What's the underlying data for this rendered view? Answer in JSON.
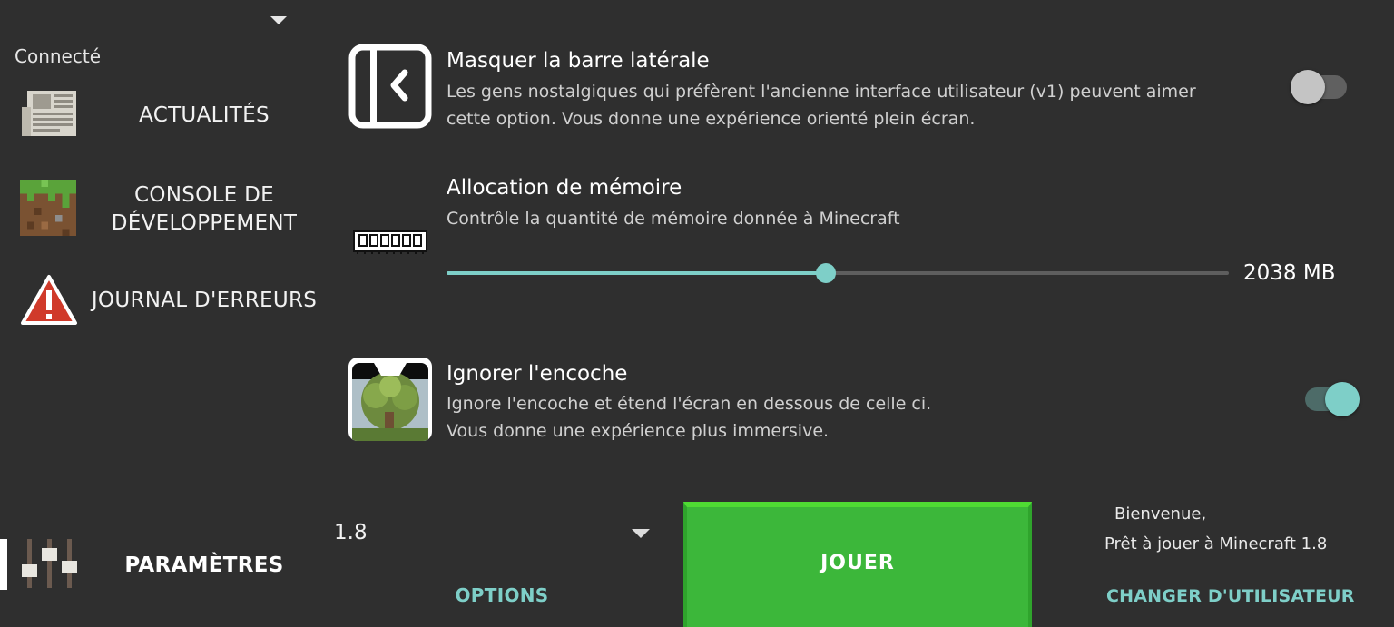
{
  "sidebar": {
    "status": "Connecté",
    "items": [
      {
        "label": "ACTUALITÉS",
        "icon": "newspaper-icon"
      },
      {
        "label_line1": "CONSOLE DE",
        "label_line2": "DÉVELOPPEMENT",
        "icon": "grass-block-icon"
      },
      {
        "label": "JOURNAL D'ERREURS",
        "icon": "warning-icon"
      },
      {
        "label": "PARAMÈTRES",
        "icon": "sliders-icon",
        "active": true
      }
    ]
  },
  "settings": {
    "hide_sidebar": {
      "title": "Masquer la barre latérale",
      "desc_line1": "Les gens nostalgiques qui préfèrent l'ancienne interface utilisateur (v1) peuvent aimer",
      "desc_line2": "cette option. Vous donne une expérience orienté plein écran.",
      "enabled": false
    },
    "memory": {
      "title": "Allocation de mémoire",
      "desc": "Contrôle la quantité de mémoire donnée à Minecraft",
      "value_label": "2038 MB",
      "fraction": 0.485
    },
    "ignore_notch": {
      "title": "Ignorer l'encoche",
      "desc_line1": "Ignore l'encoche et étend l'écran en dessous de celle ci.",
      "desc_line2": "Vous donne une expérience plus immersive.",
      "enabled": true
    }
  },
  "bottom": {
    "version": "1.8",
    "options_label": "OPTIONS",
    "play_label": "JOUER",
    "welcome": "Bienvenue,",
    "ready": "Prêt à jouer à Minecraft 1.8",
    "switch_user_label": "CHANGER D'UTILISATEUR"
  },
  "colors": {
    "background": "#2f2f2f",
    "accent": "#7ecfc8",
    "play": "#3cb73a"
  }
}
